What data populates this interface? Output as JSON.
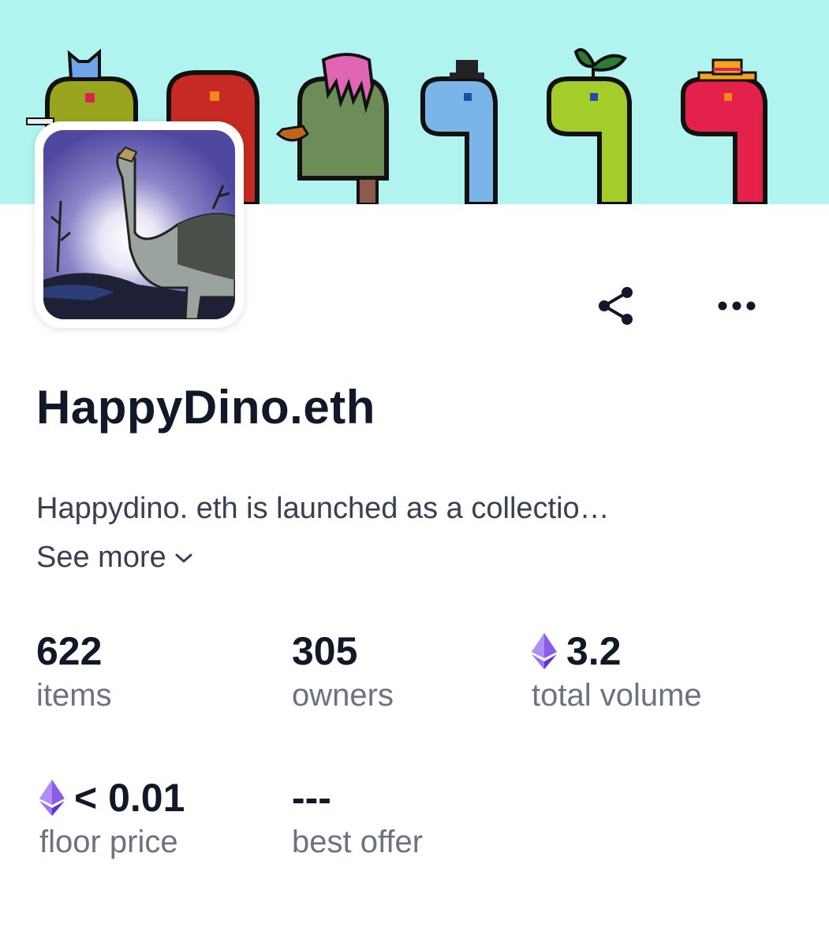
{
  "collection": {
    "title": "HappyDino.eth",
    "description": "Happydino. eth is launched as a collectio…",
    "see_more_label": "See more"
  },
  "icons": {
    "share": "share-icon",
    "more": "more-horizontal-icon",
    "eth": "ethereum-icon",
    "chevron": "chevron-down-icon"
  },
  "stats": {
    "items": {
      "value": "622",
      "label": "items"
    },
    "owners": {
      "value": "305",
      "label": "owners"
    },
    "volume": {
      "value": "3.2",
      "label": "total volume"
    },
    "floor": {
      "value": "< 0.01",
      "label": "floor price"
    },
    "offer": {
      "value": "---",
      "label": "best offer"
    }
  },
  "colors": {
    "banner_bg": "#b1f3ef",
    "eth_purple": "#7b3fe4",
    "text_primary": "#111827",
    "text_secondary": "#6b7280"
  }
}
